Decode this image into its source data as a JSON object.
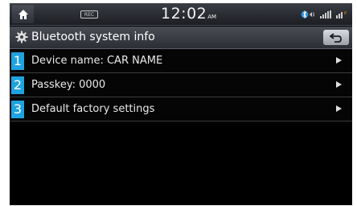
{
  "status_bar": {
    "rec_badge": "REC",
    "time": "12:02",
    "ampm": "AM",
    "icons": [
      "home-icon",
      "bluetooth-audio-icon",
      "signal-icon",
      "network-icon"
    ]
  },
  "title_bar": {
    "title": "Bluetooth system info",
    "icons": [
      "gear-icon",
      "back-arrow-icon"
    ]
  },
  "menu": {
    "items": [
      {
        "number": "1",
        "label": "Device name: CAR NAME"
      },
      {
        "number": "2",
        "label": "Passkey: 0000"
      },
      {
        "number": "3",
        "label": "Default factory settings"
      }
    ]
  },
  "colors": {
    "accent": "#1fa3e0",
    "background": "#000000",
    "text": "#eaeaea"
  }
}
